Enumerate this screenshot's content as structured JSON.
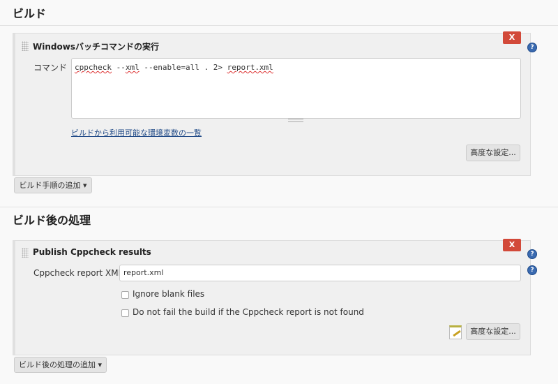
{
  "build": {
    "heading": "ビルド",
    "step_title": "Windowsバッチコマンドの実行",
    "command_label": "コマンド",
    "command_parts": [
      "cppcheck",
      " --",
      "xml",
      " --enable=all . 2> ",
      "report.xml"
    ],
    "env_link": "ビルドから利用可能な環境変数の一覧",
    "advanced": "高度な設定...",
    "add_step": "ビルド手順の追加",
    "delete": "X",
    "help": "?"
  },
  "post": {
    "heading": "ビルド後の処理",
    "step_title": "Publish Cppcheck results",
    "xml_label": "Cppcheck report XMLs",
    "xml_value": "report.xml",
    "ignore_blank": "Ignore blank files",
    "no_fail": "Do not fail the build if the Cppcheck report is not found",
    "advanced": "高度な設定...",
    "add_action": "ビルド後の処理の追加",
    "delete": "X",
    "help": "?"
  },
  "colors": {
    "delete": "#d24939",
    "link": "#204a87"
  }
}
